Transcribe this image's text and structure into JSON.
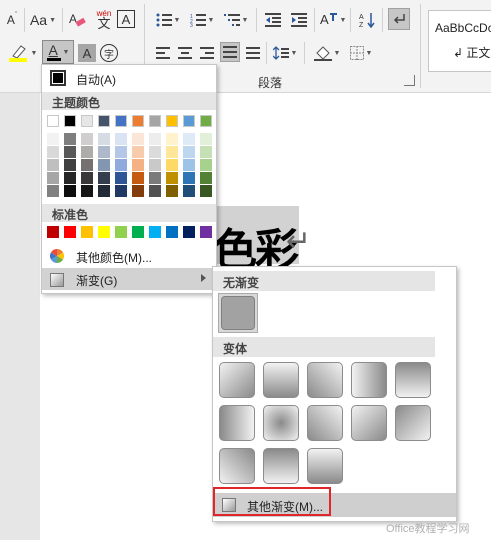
{
  "ribbon": {
    "font_grow": "A",
    "change_case": "Aa",
    "phonetic_top": "wén",
    "phonetic_bottom": "文",
    "char_border": "A",
    "font_color_letter": "A",
    "char_shading": "A",
    "enclose_char": "字",
    "group_paragraph": "段落",
    "styles_sample": "AaBbCcDc",
    "styles_name": "↲ 正文"
  },
  "colors": {
    "accent_red": "#e0262a",
    "menu_hover": "#d2d2d2",
    "header_bg": "#e5e5e5"
  },
  "color_menu": {
    "automatic": "自动(A)",
    "theme_header": "主题颜色",
    "standard_header": "标准色",
    "more_colors": "其他颜色(M)...",
    "gradient": "渐变(G)",
    "theme_top": [
      "#ffffff",
      "#000000",
      "#e7e6e6",
      "#44546a",
      "#4472c4",
      "#ed7d31",
      "#a5a5a5",
      "#ffc000",
      "#5b9bd5",
      "#70ad47"
    ],
    "theme_shades": [
      [
        "#f2f2f2",
        "#d9d9d9",
        "#bfbfbf",
        "#a6a6a6",
        "#808080"
      ],
      [
        "#7f7f7f",
        "#595959",
        "#404040",
        "#262626",
        "#0d0d0d"
      ],
      [
        "#d0cece",
        "#aeabab",
        "#757171",
        "#3a3838",
        "#171616"
      ],
      [
        "#d6dce4",
        "#adb9ca",
        "#8497b0",
        "#333f4f",
        "#222a35"
      ],
      [
        "#dae3f3",
        "#b4c7e7",
        "#8faadc",
        "#2f5597",
        "#1f3864"
      ],
      [
        "#fbe5d6",
        "#f8cbad",
        "#f4b183",
        "#c55a11",
        "#843c0c"
      ],
      [
        "#ededed",
        "#dbdbdb",
        "#c9c9c9",
        "#7b7b7b",
        "#525252"
      ],
      [
        "#fff2cc",
        "#ffe699",
        "#ffd966",
        "#bf9000",
        "#7f6000"
      ],
      [
        "#deebf7",
        "#bdd7ee",
        "#9dc3e6",
        "#2e75b6",
        "#1f4e79"
      ],
      [
        "#e2f0d9",
        "#c5e0b4",
        "#a9d18e",
        "#548235",
        "#385723"
      ]
    ],
    "standard": [
      "#c00000",
      "#ff0000",
      "#ffc000",
      "#ffff00",
      "#92d050",
      "#00b050",
      "#00b0f0",
      "#0070c0",
      "#002060",
      "#7030a0"
    ]
  },
  "document": {
    "big_text": "彩",
    "partial_char": "色",
    "paragraph_mark": "↵"
  },
  "gradient_menu": {
    "no_gradient": "无渐变",
    "variants": "变体",
    "more_gradients": "其他渐变(M)..."
  },
  "watermark": "Office教程学习网"
}
